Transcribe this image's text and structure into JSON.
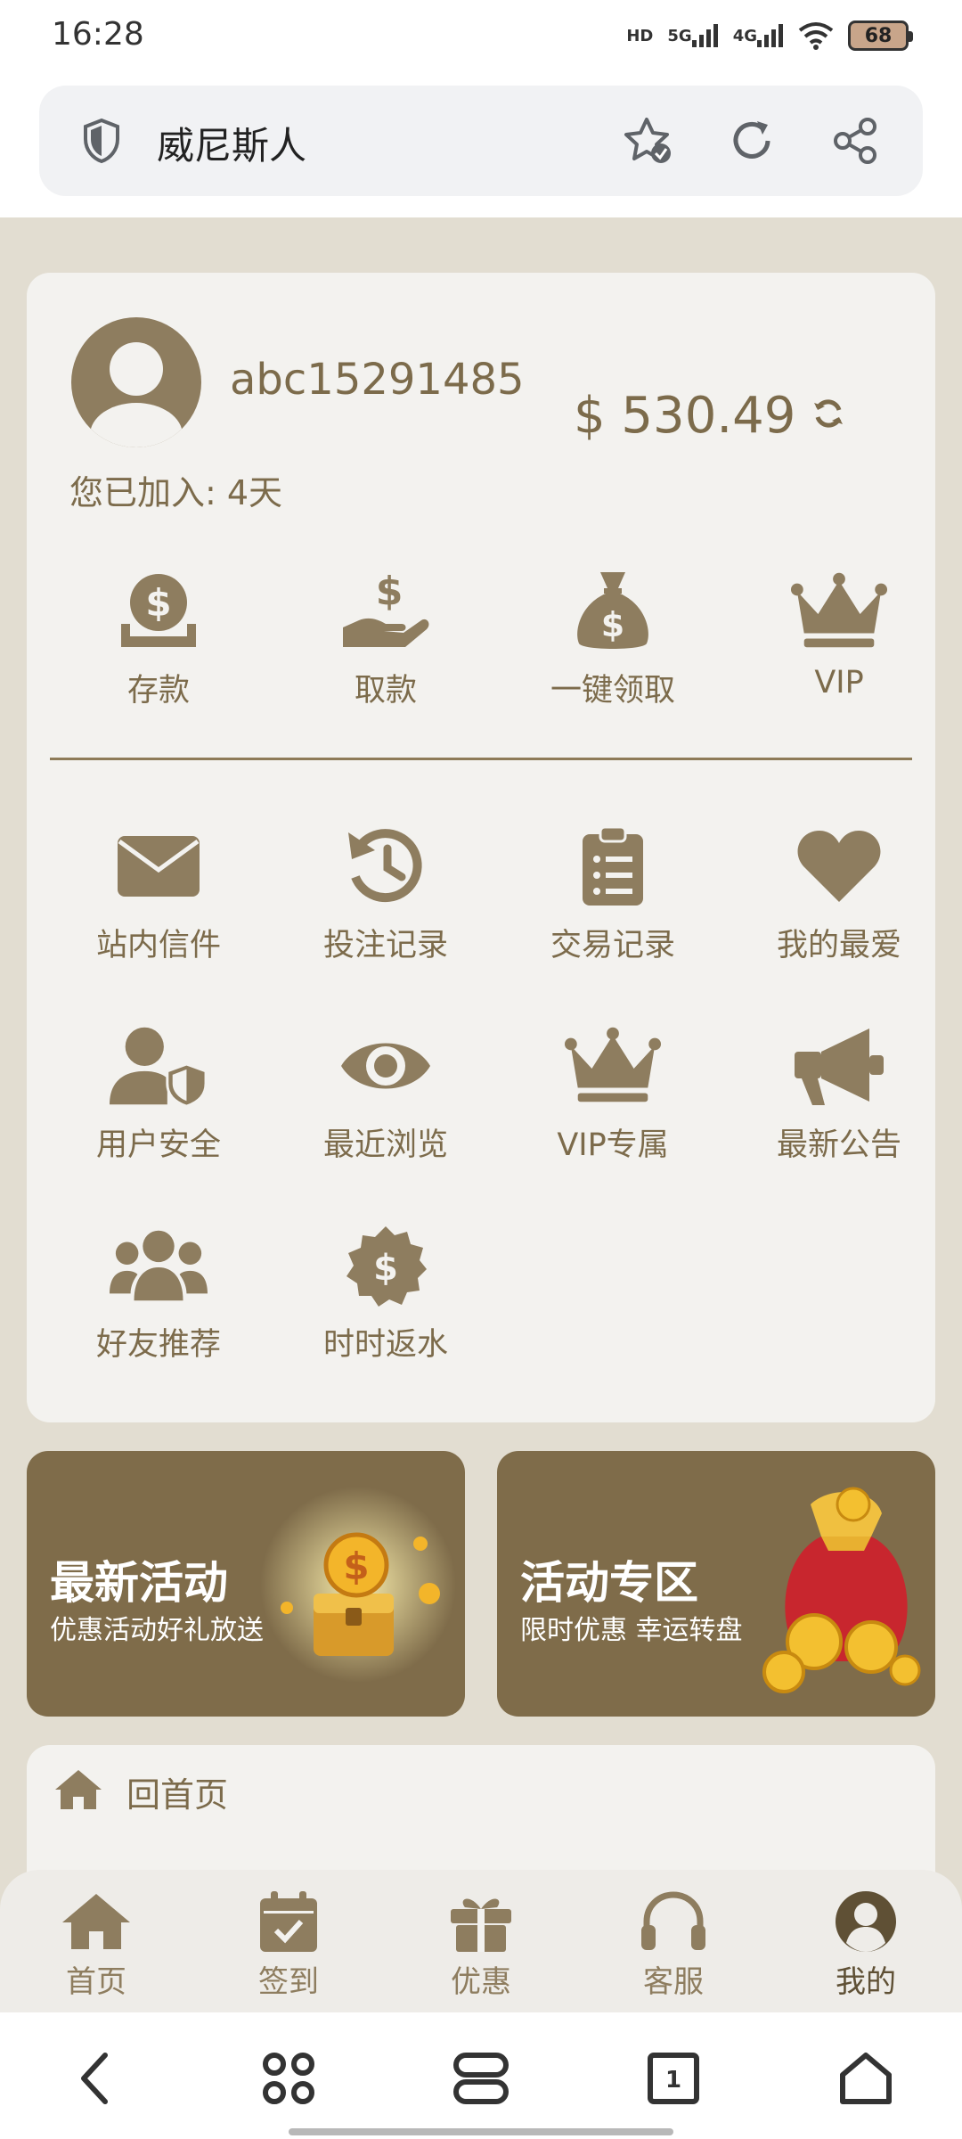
{
  "status_bar": {
    "time": "16:28",
    "net1": "HD",
    "net2": "5G",
    "net3": "4G",
    "battery": "68"
  },
  "browser": {
    "title": "威尼斯人"
  },
  "profile": {
    "username": "abc15291485",
    "joined": "您已加入: 4天",
    "balance": "$ 530.49"
  },
  "quick_actions": [
    {
      "label": "存款",
      "icon": "coin-deposit-icon"
    },
    {
      "label": "取款",
      "icon": "hand-dollar-icon"
    },
    {
      "label": "一键领取",
      "icon": "money-bag-icon"
    },
    {
      "label": "VIP",
      "icon": "crown-icon"
    }
  ],
  "features": [
    {
      "label": "站内信件",
      "icon": "envelope-icon"
    },
    {
      "label": "投注记录",
      "icon": "history-icon"
    },
    {
      "label": "交易记录",
      "icon": "clipboard-list-icon"
    },
    {
      "label": "我的最爱",
      "icon": "heart-icon"
    },
    {
      "label": "用户安全",
      "icon": "user-shield-icon"
    },
    {
      "label": "最近浏览",
      "icon": "eye-icon"
    },
    {
      "label": "VIP专属",
      "icon": "crown-icon"
    },
    {
      "label": "最新公告",
      "icon": "megaphone-icon"
    },
    {
      "label": "好友推荐",
      "icon": "users-icon"
    },
    {
      "label": "时时返水",
      "icon": "badge-dollar-icon"
    }
  ],
  "banners": [
    {
      "title": "最新活动",
      "subtitle": "优惠活动好礼放送"
    },
    {
      "title": "活动专区",
      "subtitle": "限时优惠 幸运转盘"
    }
  ],
  "menu": [
    {
      "label": "回首页",
      "icon": "home-icon"
    }
  ],
  "bottom_nav": [
    {
      "label": "首页",
      "icon": "home-icon"
    },
    {
      "label": "签到",
      "icon": "calendar-check-icon"
    },
    {
      "label": "优惠",
      "icon": "gift-icon"
    },
    {
      "label": "客服",
      "icon": "headset-icon"
    },
    {
      "label": "我的",
      "icon": "user-circle-icon",
      "active": true
    }
  ],
  "colors": {
    "accent": "#7f6c4a",
    "icon": "#8e7d5f",
    "card": "#f3f2ef",
    "page": "#e2ddd1"
  }
}
